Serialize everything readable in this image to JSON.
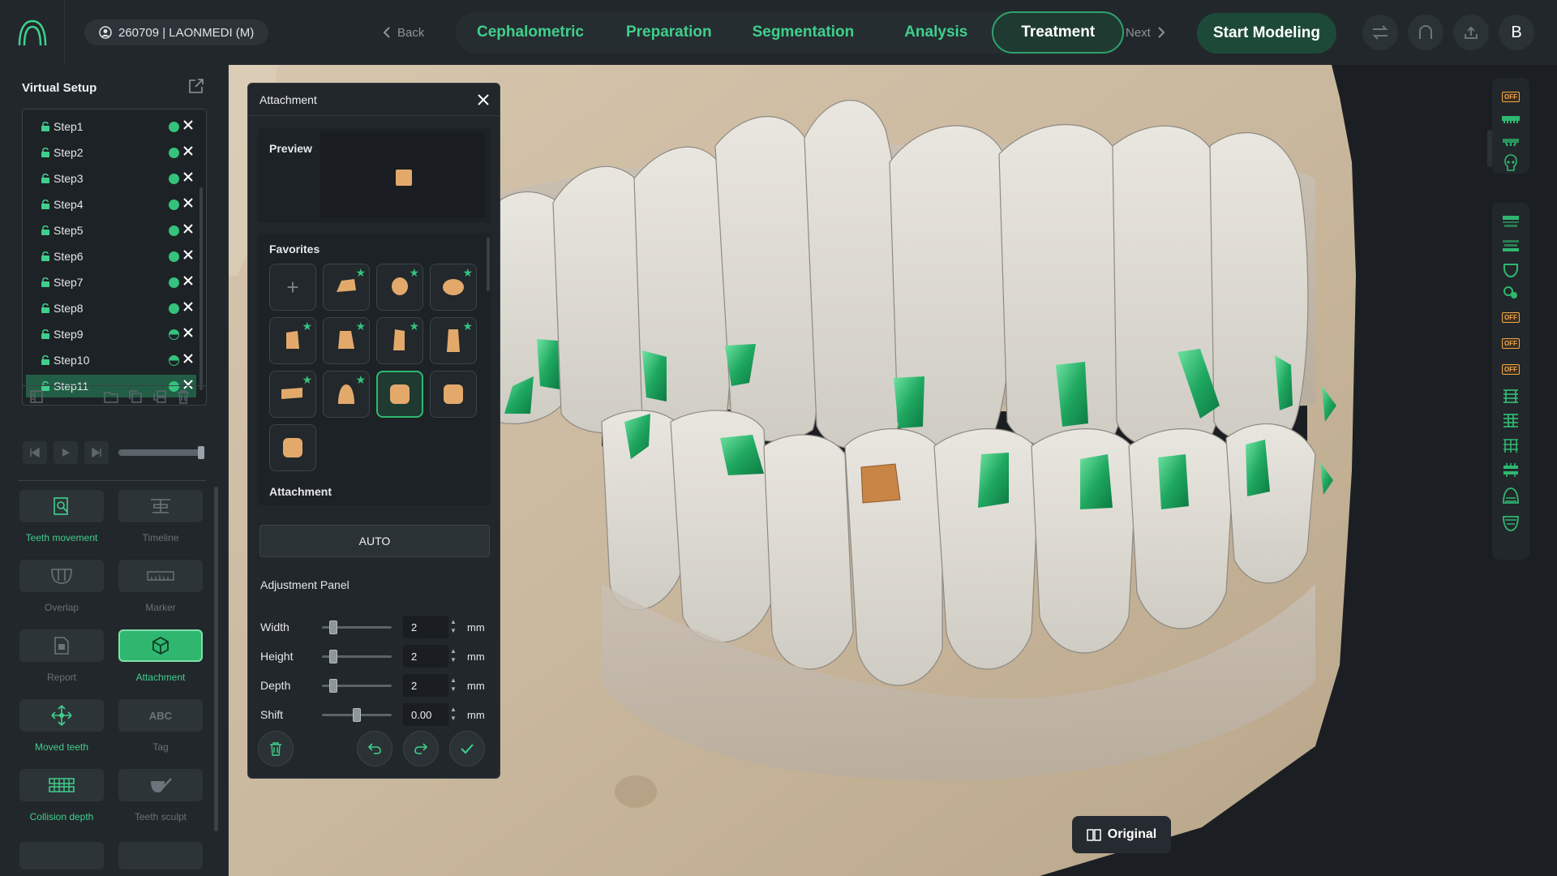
{
  "header": {
    "patient": "260709 | LAONMEDI (M)",
    "back_label": "Back",
    "next_label": "Next",
    "stages": [
      "Cephalometric",
      "Preparation",
      "Segmentation",
      "Analysis",
      "Treatment"
    ],
    "active_stage": "Treatment",
    "start_label": "Start Modeling",
    "user_initial": "B",
    "icons": [
      "swap-icon",
      "home-icon",
      "upload-icon"
    ]
  },
  "sidebar": {
    "title": "Virtual Setup",
    "steps": [
      {
        "label": "Step1",
        "status": "full"
      },
      {
        "label": "Step2",
        "status": "full"
      },
      {
        "label": "Step3",
        "status": "full"
      },
      {
        "label": "Step4",
        "status": "full"
      },
      {
        "label": "Step5",
        "status": "full"
      },
      {
        "label": "Step6",
        "status": "full"
      },
      {
        "label": "Step7",
        "status": "full"
      },
      {
        "label": "Step8",
        "status": "full"
      },
      {
        "label": "Step9",
        "status": "half"
      },
      {
        "label": "Step10",
        "status": "half"
      },
      {
        "label": "Step11",
        "status": "full",
        "selected": true
      }
    ],
    "tools": [
      {
        "label": "Teeth movement",
        "state": "on",
        "icon": "magnifier-icon"
      },
      {
        "label": "Timeline",
        "state": "off",
        "icon": "timeline-icon"
      },
      {
        "label": "Overlap",
        "state": "off",
        "icon": "overlap-icon"
      },
      {
        "label": "Marker",
        "state": "off",
        "icon": "ruler-icon"
      },
      {
        "label": "Report",
        "state": "off",
        "icon": "report-icon"
      },
      {
        "label": "Attachment",
        "state": "active",
        "icon": "cube-icon"
      },
      {
        "label": "Moved teeth",
        "state": "on",
        "icon": "move-icon"
      },
      {
        "label": "Tag",
        "state": "off",
        "icon": "tag-icon",
        "icon_text": "ABC"
      },
      {
        "label": "Collision depth",
        "state": "on",
        "icon": "collision-icon"
      },
      {
        "label": "Teeth sculpt",
        "state": "off",
        "icon": "sculpt-icon"
      }
    ]
  },
  "attachment_panel": {
    "title": "Attachment",
    "preview_label": "Preview",
    "favorites_label": "Favorites",
    "attachment_label": "Attachment",
    "auto_label": "AUTO",
    "adjust_title": "Adjustment Panel",
    "params": [
      {
        "name": "Width",
        "value": "2",
        "unit": "mm",
        "level": 0.12
      },
      {
        "name": "Height",
        "value": "2",
        "unit": "mm",
        "level": 0.12
      },
      {
        "name": "Depth",
        "value": "2",
        "unit": "mm",
        "level": 0.12
      },
      {
        "name": "Shift",
        "value": "0.00",
        "unit": "mm",
        "level": 0.5
      }
    ],
    "favorites": [
      {
        "shape": "add",
        "starred": false
      },
      {
        "shape": "wedge",
        "starred": true
      },
      {
        "shape": "oval",
        "starred": true
      },
      {
        "shape": "oval-wide",
        "starred": true
      },
      {
        "shape": "tall-bevel",
        "starred": true
      },
      {
        "shape": "tall-bevel-2",
        "starred": true
      },
      {
        "shape": "tall-bevel-3",
        "starred": true
      },
      {
        "shape": "tall-long",
        "starred": true
      },
      {
        "shape": "flat-bar",
        "starred": true
      },
      {
        "shape": "bell",
        "starred": true
      },
      {
        "shape": "rounded-square",
        "starred": false,
        "selected": true
      },
      {
        "shape": "rounded-square",
        "starred": false
      },
      {
        "shape": "rounded-square",
        "starred": false
      }
    ]
  },
  "viewport": {
    "original_label": "Original",
    "scene": "3d-dental-model"
  },
  "right_toolbar": {
    "off_label": "OFF",
    "top_icons": [
      "off-toggle",
      "upper-arch-icon",
      "lower-arch-icon",
      "skull-icon"
    ],
    "bottom_icons": [
      "upper-jaw-icon",
      "lower-jaw-icon",
      "tooth-icon",
      "gum-icon",
      "off-toggle",
      "off-toggle",
      "off-toggle",
      "ipr-icon",
      "grid-upper-icon",
      "grid-lower-icon",
      "arch-form-icon",
      "occlusal-icon",
      "mesh-icon"
    ]
  },
  "colors": {
    "accent": "#35c27c",
    "attachment_green": "#1fa860",
    "attachment_orange": "#e3a96b",
    "panel_bg": "#22272b"
  }
}
